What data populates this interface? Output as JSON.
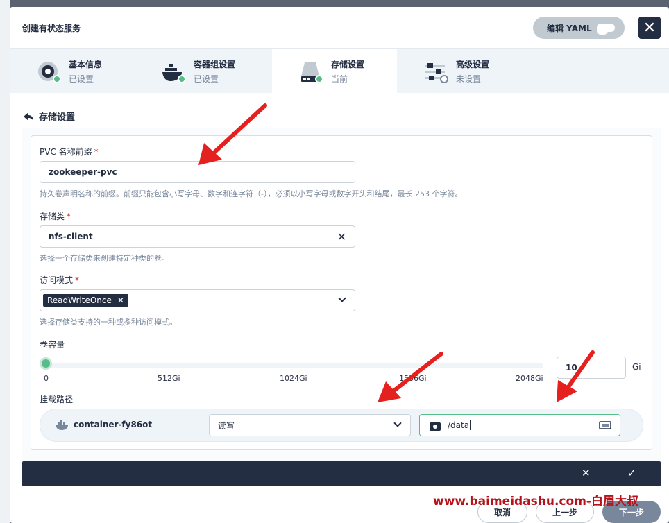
{
  "modal": {
    "title": "创建有状态服务",
    "yaml_label": "编辑 YAML",
    "close_label": "✕"
  },
  "tabs": [
    {
      "name": "基本信息",
      "status": "已设置"
    },
    {
      "name": "容器组设置",
      "status": "已设置"
    },
    {
      "name": "存储设置",
      "status": "当前"
    },
    {
      "name": "高级设置",
      "status": "未设置"
    }
  ],
  "section": {
    "title": "存储设置"
  },
  "form": {
    "pvc_prefix": {
      "label": "PVC 名称前缀",
      "value": "zookeeper-pvc",
      "hint": "持久卷声明名称的前缀。前缀只能包含小写字母、数字和连字符（-），必须以小写字母或数字开头和结尾，最长 253 个字符。"
    },
    "storage_class": {
      "label": "存储类",
      "value": "nfs-client",
      "hint": "选择一个存储类来创建特定种类的卷。"
    },
    "access_mode": {
      "label": "访问模式",
      "tag": "ReadWriteOnce",
      "hint": "选择存储类支持的一种或多种访问模式。"
    },
    "capacity": {
      "label": "卷容量",
      "value": "10",
      "unit": "Gi",
      "ticks": [
        "0",
        "512Gi",
        "1024Gi",
        "1536Gi",
        "2048Gi"
      ]
    },
    "mount": {
      "label": "挂载路径",
      "container": "container-fy86ot",
      "mode": "读写",
      "path": "/data"
    },
    "required_mark": "*"
  },
  "footer": {
    "cancel": "取消",
    "prev": "上一步",
    "next": "下一步"
  },
  "watermark": "www.baimeidashu.com-白眉大叔",
  "colors": {
    "primary": "#242e42",
    "success": "#55bc8a",
    "muted": "#79879c",
    "annotation": "#e5211f"
  }
}
